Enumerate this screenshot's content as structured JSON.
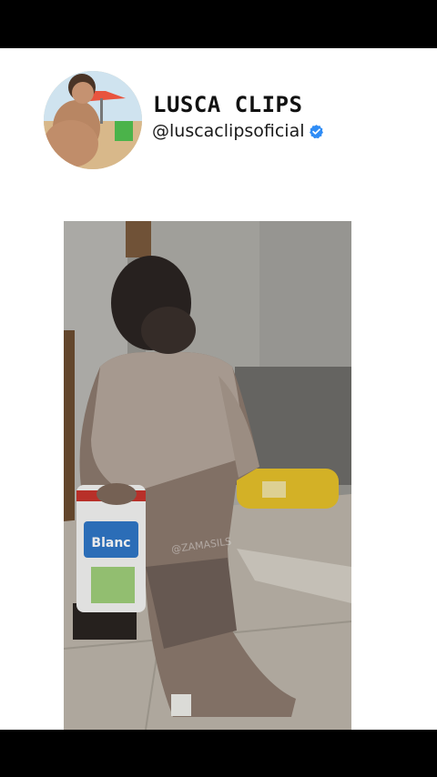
{
  "channel": {
    "name": "LUSCA CLIPS",
    "handle": "@luscaclipsoficial",
    "verified": true,
    "verified_color": "#2f8cf5"
  },
  "video": {
    "watermark": "@ZAMASILS",
    "product_label": "Blanc"
  },
  "icons": {
    "verified": "verified-badge-icon",
    "avatar": "profile-photo"
  },
  "colors": {
    "background": "#ffffff",
    "letterbox": "#000000",
    "text": "#111111"
  }
}
